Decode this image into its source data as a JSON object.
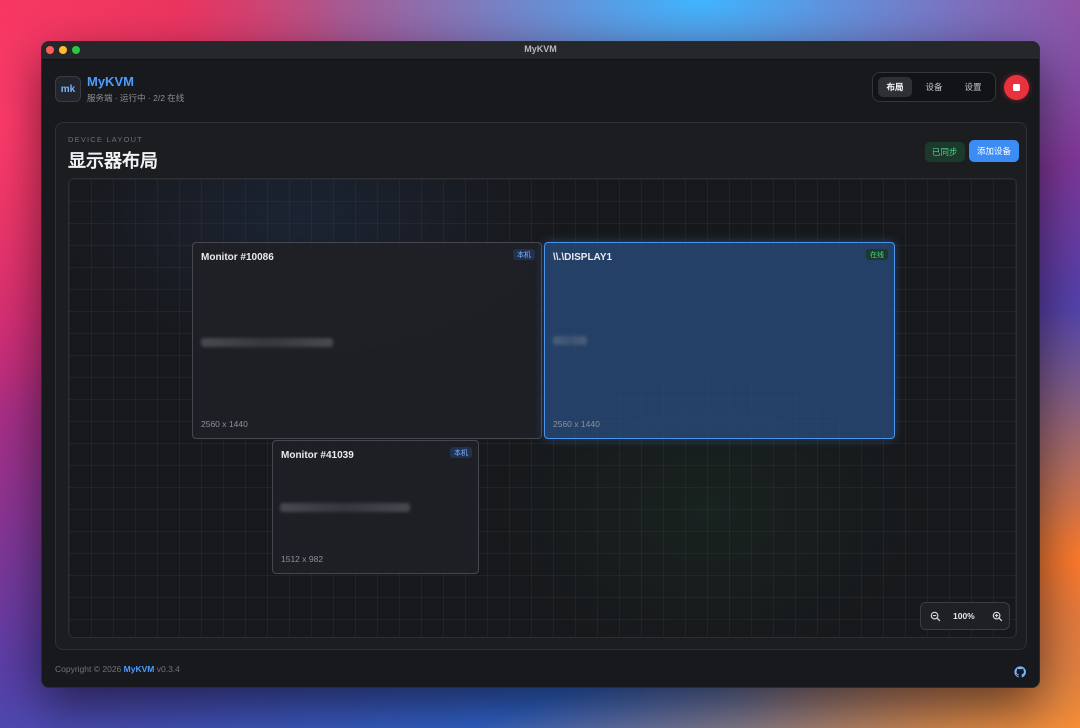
{
  "window": {
    "title": "MyKVM"
  },
  "header": {
    "logo_text": "mk",
    "app_name": "MyKVM",
    "status": "服务端 · 运行中 · 2/2 在线",
    "tabs": [
      {
        "label": "布局",
        "active": true
      },
      {
        "label": "设备",
        "active": false
      },
      {
        "label": "设置",
        "active": false
      }
    ],
    "stop_icon": "stop-square-icon"
  },
  "layout": {
    "eyebrow": "DEVICE LAYOUT",
    "title": "显示器布局",
    "sync_status": "已同步",
    "add_device": "添加设备",
    "monitors": [
      {
        "name": "Monitor #10086",
        "badge": "本机",
        "resolution": "2560 x 1440",
        "selected": false
      },
      {
        "name": "\\\\.\\DISPLAY1",
        "badge": "在线",
        "resolution": "2560 x 1440",
        "selected": true
      },
      {
        "name": "Monitor #41039",
        "badge": "本机",
        "resolution": "1512 x 982",
        "selected": false
      }
    ],
    "zoom": {
      "value": "100%",
      "zoom_out_icon": "zoom-out-icon",
      "zoom_in_icon": "zoom-in-icon"
    }
  },
  "footer": {
    "copyright": "Copyright © 2026",
    "brand": "MyKVM",
    "version": "v0.3.4",
    "github_icon": "github-icon"
  },
  "colors": {
    "accent": "#3b8cf5",
    "stop": "#e8333f",
    "online": "#4fd08a"
  }
}
